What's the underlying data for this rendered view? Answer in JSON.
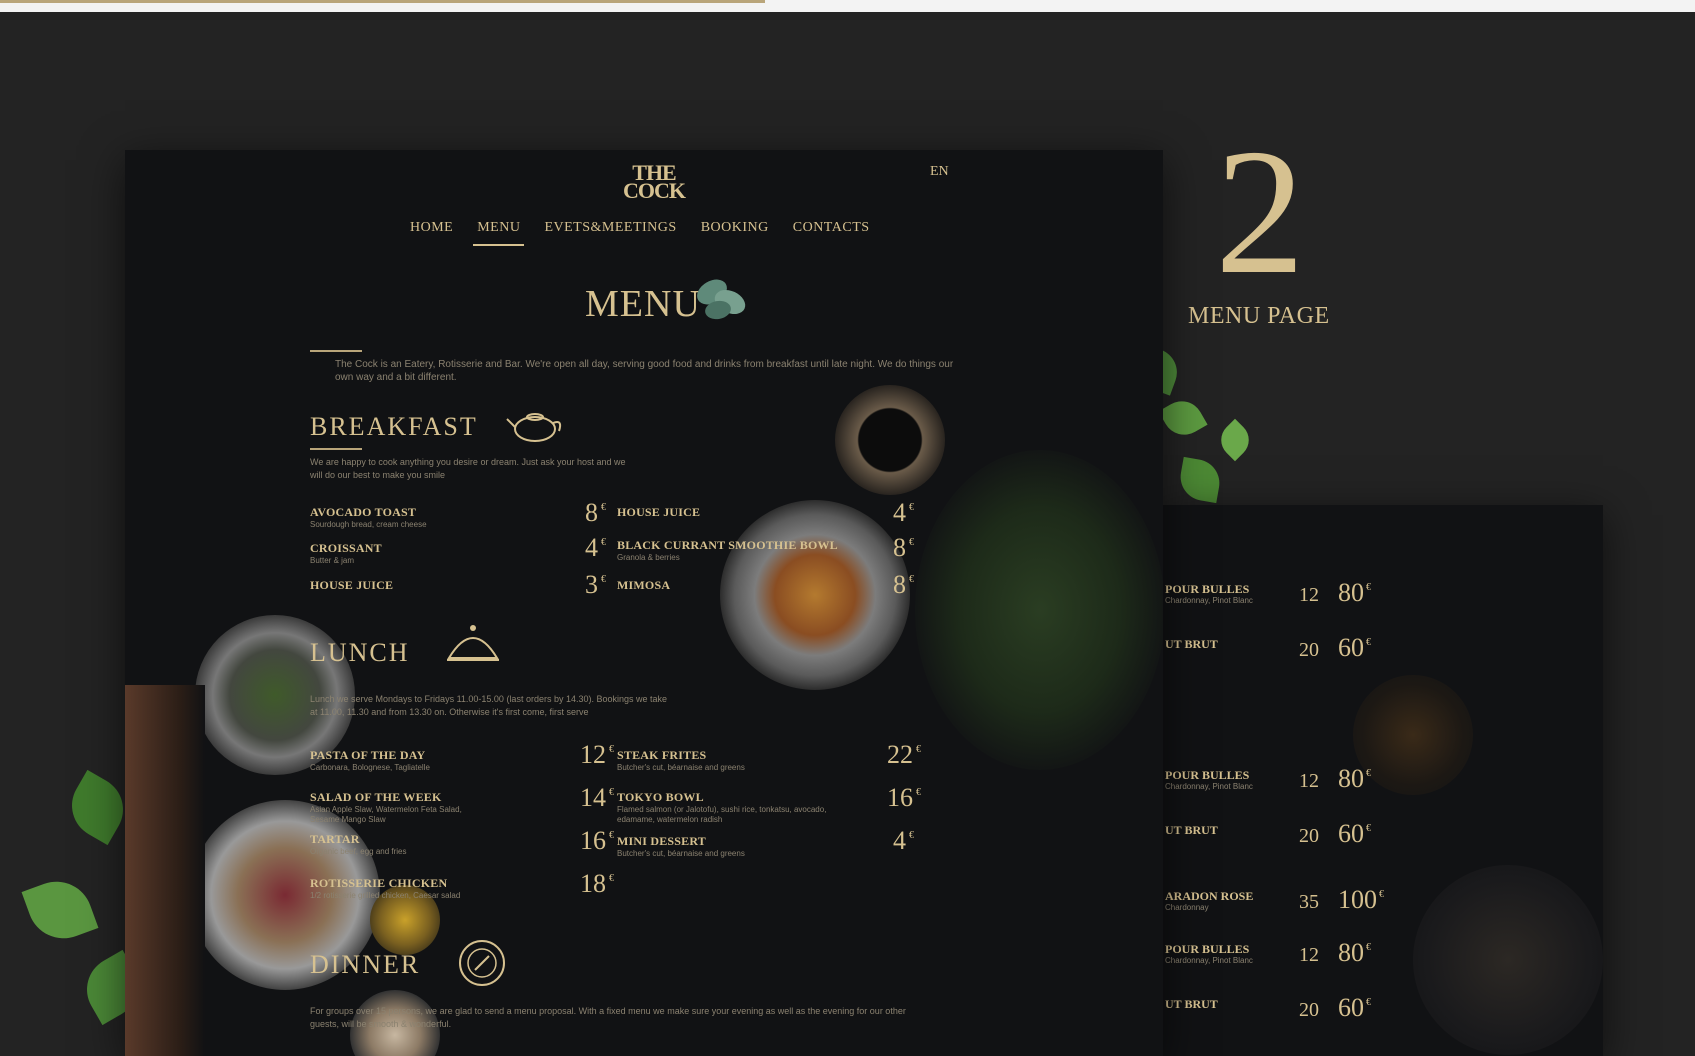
{
  "showcase": {
    "number": "2",
    "label": "MENU PAGE",
    "accent_color": "#d6c190"
  },
  "site": {
    "logo_line1": "THE",
    "logo_line2": "COCK",
    "language": "EN",
    "nav": [
      "HOME",
      "MENU",
      "EVETS&MEETINGS",
      "BOOKING",
      "CONTACTS"
    ],
    "active_nav": "MENU"
  },
  "menu": {
    "title": "MENU",
    "intro": "The Cock is an Eatery, Rotisserie and Bar. We're open all day, serving good food and drinks from breakfast until late night. We do things our own way and a bit different.",
    "breakfast": {
      "title": "BREAKFAST",
      "desc": "We are happy to cook anything you desire or dream. Just ask your host and we will do our best to make you smile",
      "items": [
        {
          "name": "AVOCADO TOAST",
          "desc": "Sourdough bread, cream cheese",
          "price": "8"
        },
        {
          "name": "CROISSANT",
          "desc": "Butter & jam",
          "price": "4"
        },
        {
          "name": "HOUSE JUICE",
          "desc": "",
          "price": "3"
        },
        {
          "name": "HOUSE JUICE",
          "desc": "",
          "price": "4"
        },
        {
          "name": "BLACK CURRANT SMOOTHIE BOWL",
          "desc": "Granola & berries",
          "price": "8"
        },
        {
          "name": "MIMOSA",
          "desc": "",
          "price": "8"
        }
      ]
    },
    "lunch": {
      "title": "LUNCH",
      "desc": "Lunch we serve Mondays to Fridays 11.00-15.00 (last orders by 14.30). Bookings we take at 11.00, 11.30 and from 13.30 on. Otherwise it's first come, first serve",
      "items": [
        {
          "name": "PASTA OF THE DAY",
          "desc": "Carbonara, Bolognese, Tagliatelle",
          "price": "12"
        },
        {
          "name": "SALAD OF THE WEEK",
          "desc": "Asian Apple Slaw, Watermelon Feta Salad, Sesame Mango Slaw",
          "price": "14"
        },
        {
          "name": "TARTAR",
          "desc": "Organic beef, egg and fries",
          "price": "16"
        },
        {
          "name": "ROTISSERIE CHICKEN",
          "desc": "1/2 rotisserie grilled chicken, Caesar salad",
          "price": "18"
        },
        {
          "name": "STEAK FRITES",
          "desc": "Butcher's cut, béarnaise and greens",
          "price": "22"
        },
        {
          "name": "TOKYO BOWL",
          "desc": "Flamed salmon (or Jalotofu), sushi rice, tonkatsu, avocado, edamame, watermelon radish",
          "price": "16"
        },
        {
          "name": "MINI DESSERT",
          "desc": "Butcher's cut, béarnaise and greens",
          "price": "4"
        }
      ]
    },
    "dinner": {
      "title": "DINNER",
      "desc": "For groups over 15 persons, we are glad to send a menu proposal. With a fixed menu we make sure your evening as well as the evening for our other guests, will be smooth & wonderful."
    },
    "currency": "€"
  },
  "drinks_page": {
    "rows": [
      {
        "name": "POUR BULLES",
        "sub": "Chardonnay, Pinot Blanc",
        "glass": "12",
        "bottle": "80"
      },
      {
        "name": "UT BRUT",
        "sub": "",
        "glass": "20",
        "bottle": "60"
      },
      {
        "name": "POUR BULLES",
        "sub": "Chardonnay, Pinot Blanc",
        "glass": "12",
        "bottle": "80"
      },
      {
        "name": "UT BRUT",
        "sub": "",
        "glass": "20",
        "bottle": "60"
      },
      {
        "name": "ARADON ROSE",
        "sub": "Chardonnay",
        "glass": "35",
        "bottle": "100"
      },
      {
        "name": "POUR BULLES",
        "sub": "Chardonnay, Pinot Blanc",
        "glass": "12",
        "bottle": "80"
      },
      {
        "name": "UT BRUT",
        "sub": "",
        "glass": "20",
        "bottle": "60"
      }
    ]
  }
}
